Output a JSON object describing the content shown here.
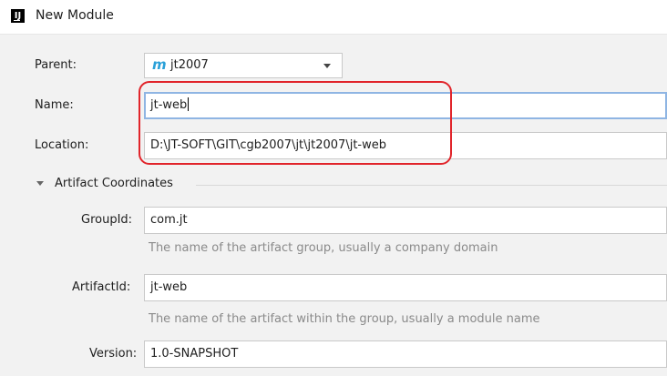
{
  "window": {
    "title": "New Module",
    "app_icon": "intellij-icon"
  },
  "form": {
    "parent": {
      "label": "Parent:",
      "value": "jt2007",
      "icon": "maven-module-icon"
    },
    "name": {
      "label": "Name:",
      "value": "jt-web"
    },
    "location": {
      "label": "Location:",
      "value": "D:\\JT-SOFT\\GIT\\cgb2007\\jt\\jt2007\\jt-web"
    }
  },
  "artifact": {
    "section_title": "Artifact Coordinates",
    "group_id": {
      "label": "GroupId:",
      "value": "com.jt",
      "hint": "The name of the artifact group, usually a company domain"
    },
    "artifact_id": {
      "label": "ArtifactId:",
      "value": "jt-web",
      "hint": "The name of the artifact within the group, usually a module name"
    },
    "version": {
      "label": "Version:",
      "value": "1.0-SNAPSHOT"
    }
  },
  "colors": {
    "highlight_border": "#e1252b",
    "focus_border": "#8fb5e3",
    "maven_icon": "#2aa0d8"
  }
}
